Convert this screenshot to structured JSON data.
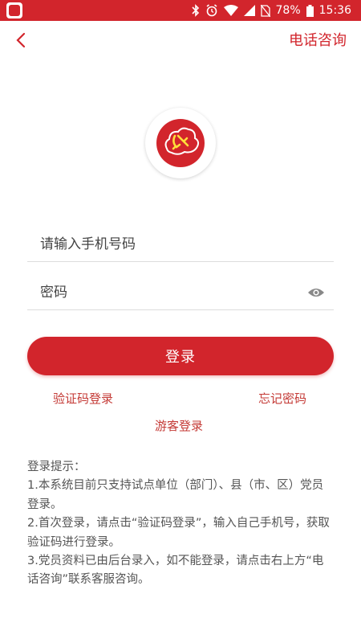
{
  "status_bar": {
    "battery": "78%",
    "time": "15:36",
    "icons": [
      "app-icon",
      "bluetooth-icon",
      "alarm-icon",
      "wifi-icon",
      "signal-icon",
      "no-sim-icon",
      "battery-icon"
    ]
  },
  "nav": {
    "back_icon": "chevron-left-icon",
    "phone_consult": "电话咨询"
  },
  "logo": {
    "icon": "party-emblem-cloud-logo",
    "color": "#d2252c"
  },
  "form": {
    "phone_placeholder": "请输入手机号码",
    "password_placeholder": "密码",
    "eye_icon": "eye-icon",
    "login_button": "登录"
  },
  "links": {
    "code_login": "验证码登录",
    "forgot_password": "忘记密码",
    "guest_login": "游客登录"
  },
  "tips": {
    "title": "登录提示：",
    "lines": [
      "1.本系统目前只支持试点单位（部门）、县（市、区）党员登录。",
      "2.首次登录，请点击“验证码登录”，输入自己手机号，获取验证码进行登录。",
      "3.党员资料已由后台录入，如不能登录，请点击右上方“电话咨询”联系客服咨询。"
    ]
  },
  "colors": {
    "accent": "#d2252c",
    "link": "#c43a36",
    "text": "#555555"
  }
}
